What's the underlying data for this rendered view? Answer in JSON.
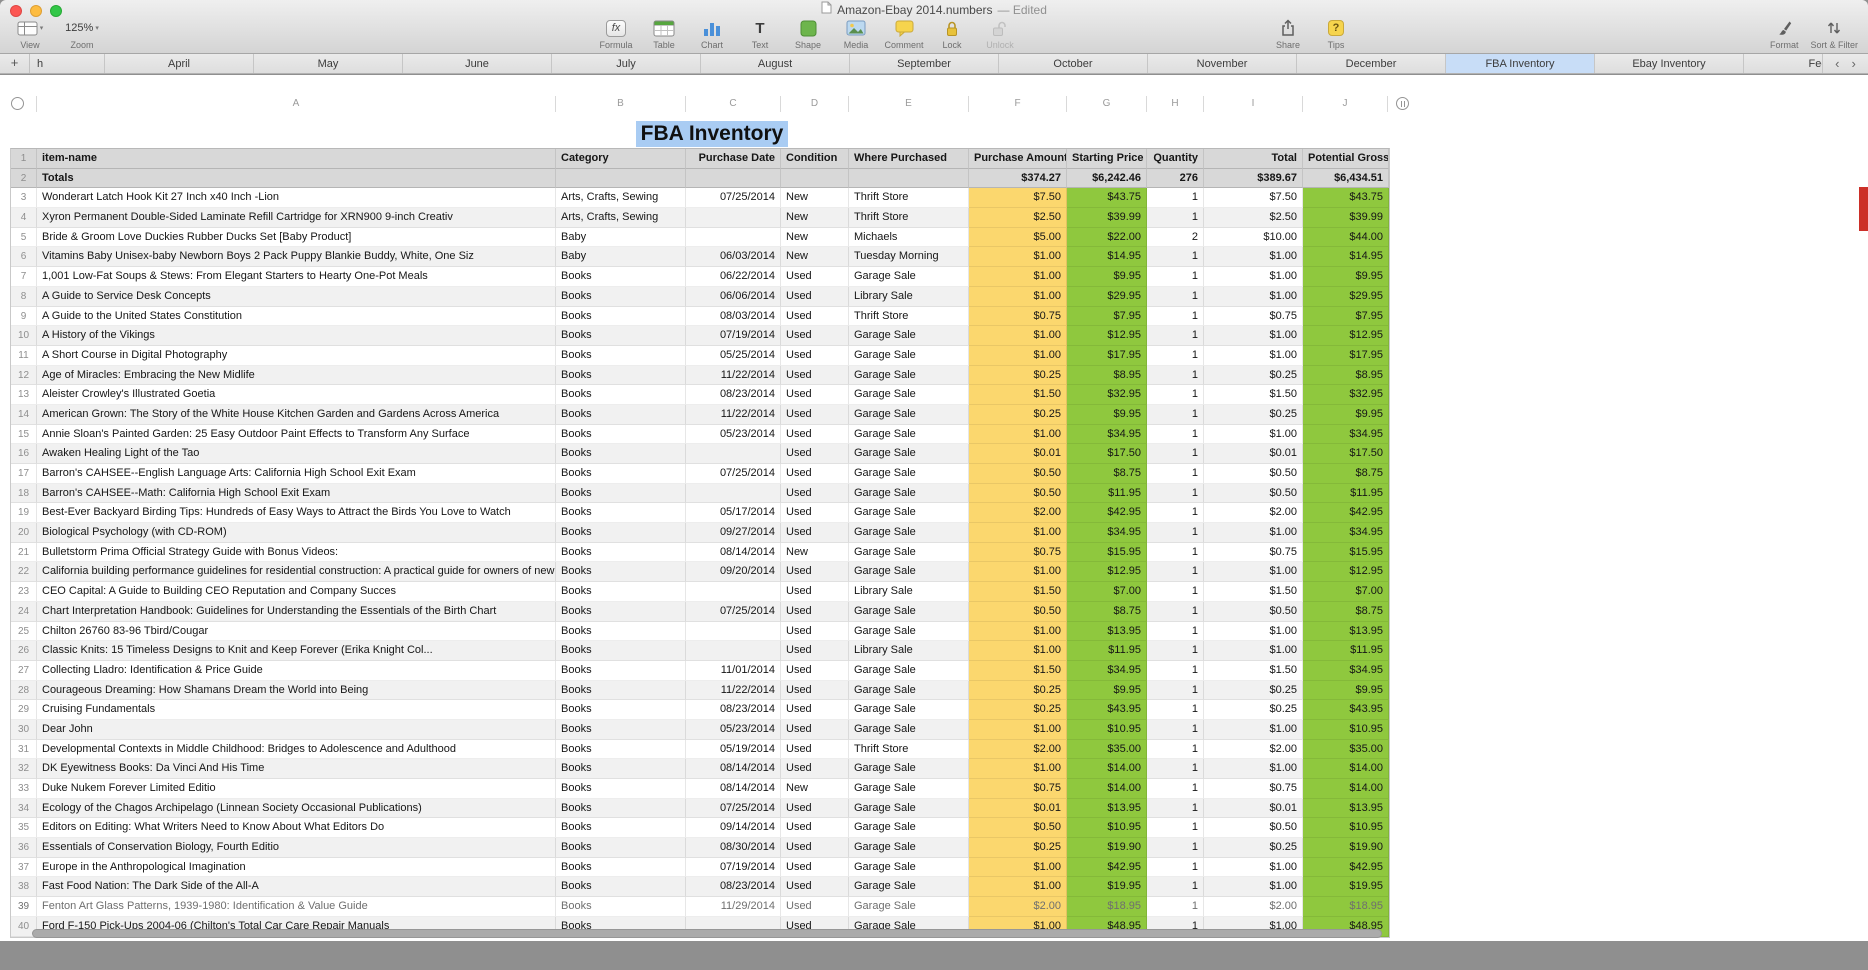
{
  "window": {
    "title": "Amazon-Ebay 2014.numbers",
    "edited": "— Edited"
  },
  "toolbar": {
    "view": {
      "label": "View"
    },
    "zoom": {
      "label": "Zoom",
      "value": "125%"
    },
    "buttons": [
      {
        "label": "Formula"
      },
      {
        "label": "Table"
      },
      {
        "label": "Chart"
      },
      {
        "label": "Text"
      },
      {
        "label": "Shape"
      },
      {
        "label": "Media"
      },
      {
        "label": "Comment"
      },
      {
        "label": "Lock"
      },
      {
        "label": "Unlock"
      }
    ],
    "share": {
      "label": "Share"
    },
    "tips": {
      "label": "Tips"
    },
    "format": {
      "label": "Format"
    },
    "sort_filter": {
      "label": "Sort & Filter"
    }
  },
  "sheet_tabs": {
    "add_label": "+",
    "partial_label": "h",
    "items": [
      "April",
      "May",
      "June",
      "July",
      "August",
      "September",
      "October",
      "November",
      "December",
      "FBA Inventory",
      "Ebay Inventory",
      "Fee"
    ],
    "selected": "FBA Inventory",
    "nav_prev": "‹",
    "nav_next": "›"
  },
  "column_letters": [
    "A",
    "B",
    "C",
    "D",
    "E",
    "F",
    "G",
    "H",
    "I",
    "J"
  ],
  "sheet": {
    "title": "FBA Inventory",
    "table": {
      "header_row": {
        "num": "1",
        "cells": [
          "item-name",
          "Category",
          "Purchase Date",
          "Condition",
          "Where Purchased",
          "Purchase Amount",
          "Starting Price",
          "Quantity",
          "Total",
          "Potential Gross"
        ]
      },
      "totals_row": {
        "num": "2",
        "cells": [
          "Totals",
          "",
          "",
          "",
          "",
          "$374.27",
          "$6,242.46",
          "276",
          "$389.67",
          "$6,434.51"
        ]
      },
      "muted_row_numbers": [
        "39"
      ],
      "rows": [
        [
          "3",
          "Wonderart Latch Hook Kit 27 Inch x40 Inch -Lion",
          "Arts, Crafts, Sewing",
          "07/25/2014",
          "New",
          "Thrift Store",
          "$7.50",
          "$43.75",
          "1",
          "$7.50",
          "$43.75"
        ],
        [
          "4",
          "Xyron Permanent Double-Sided Laminate Refill Cartridge for XRN900 9-inch Creativ",
          "Arts, Crafts, Sewing",
          "",
          "New",
          "Thrift Store",
          "$2.50",
          "$39.99",
          "1",
          "$2.50",
          "$39.99"
        ],
        [
          "5",
          "Bride & Groom Love Duckies Rubber Ducks Set [Baby Product]",
          "Baby",
          "",
          "New",
          "Michaels",
          "$5.00",
          "$22.00",
          "2",
          "$10.00",
          "$44.00"
        ],
        [
          "6",
          "Vitamins Baby Unisex-baby Newborn Boys 2 Pack Puppy Blankie Buddy, White, One Siz",
          "Baby",
          "06/03/2014",
          "New",
          "Tuesday Morning",
          "$1.00",
          "$14.95",
          "1",
          "$1.00",
          "$14.95"
        ],
        [
          "7",
          "1,001 Low-Fat Soups & Stews: From Elegant Starters to Hearty One-Pot Meals",
          "Books",
          "06/22/2014",
          "Used",
          "Garage Sale",
          "$1.00",
          "$9.95",
          "1",
          "$1.00",
          "$9.95"
        ],
        [
          "8",
          "A Guide to Service Desk Concepts",
          "Books",
          "06/06/2014",
          "Used",
          "Library Sale",
          "$1.00",
          "$29.95",
          "1",
          "$1.00",
          "$29.95"
        ],
        [
          "9",
          "A Guide to the United States Constitution",
          "Books",
          "08/03/2014",
          "Used",
          "Thrift Store",
          "$0.75",
          "$7.95",
          "1",
          "$0.75",
          "$7.95"
        ],
        [
          "10",
          "A History of the Vikings",
          "Books",
          "07/19/2014",
          "Used",
          "Garage Sale",
          "$1.00",
          "$12.95",
          "1",
          "$1.00",
          "$12.95"
        ],
        [
          "11",
          "A Short Course in Digital Photography",
          "Books",
          "05/25/2014",
          "Used",
          "Garage Sale",
          "$1.00",
          "$17.95",
          "1",
          "$1.00",
          "$17.95"
        ],
        [
          "12",
          "Age of Miracles: Embracing the New Midlife",
          "Books",
          "11/22/2014",
          "Used",
          "Garage Sale",
          "$0.25",
          "$8.95",
          "1",
          "$0.25",
          "$8.95"
        ],
        [
          "13",
          "Aleister Crowley's Illustrated Goetia",
          "Books",
          "08/23/2014",
          "Used",
          "Garage Sale",
          "$1.50",
          "$32.95",
          "1",
          "$1.50",
          "$32.95"
        ],
        [
          "14",
          "American Grown: The Story of the White House Kitchen Garden and Gardens Across America",
          "Books",
          "11/22/2014",
          "Used",
          "Garage Sale",
          "$0.25",
          "$9.95",
          "1",
          "$0.25",
          "$9.95"
        ],
        [
          "15",
          "Annie Sloan's Painted Garden: 25 Easy Outdoor Paint Effects to Transform Any Surface",
          "Books",
          "05/23/2014",
          "Used",
          "Garage Sale",
          "$1.00",
          "$34.95",
          "1",
          "$1.00",
          "$34.95"
        ],
        [
          "16",
          "Awaken Healing Light of the Tao",
          "Books",
          "",
          "Used",
          "Garage Sale",
          "$0.01",
          "$17.50",
          "1",
          "$0.01",
          "$17.50"
        ],
        [
          "17",
          "Barron's CAHSEE--English Language Arts: California High School Exit Exam",
          "Books",
          "07/25/2014",
          "Used",
          "Garage Sale",
          "$0.50",
          "$8.75",
          "1",
          "$0.50",
          "$8.75"
        ],
        [
          "18",
          "Barron's CAHSEE--Math: California High School Exit Exam",
          "Books",
          "",
          "Used",
          "Garage Sale",
          "$0.50",
          "$11.95",
          "1",
          "$0.50",
          "$11.95"
        ],
        [
          "19",
          "Best-Ever Backyard Birding Tips: Hundreds of Easy Ways to Attract the Birds You Love to Watch",
          "Books",
          "05/17/2014",
          "Used",
          "Garage Sale",
          "$2.00",
          "$42.95",
          "1",
          "$2.00",
          "$42.95"
        ],
        [
          "20",
          "Biological Psychology (with CD-ROM)",
          "Books",
          "09/27/2014",
          "Used",
          "Garage Sale",
          "$1.00",
          "$34.95",
          "1",
          "$1.00",
          "$34.95"
        ],
        [
          "21",
          "Bulletstorm Prima Official Strategy Guide with Bonus Videos:",
          "Books",
          "08/14/2014",
          "New",
          "Garage Sale",
          "$0.75",
          "$15.95",
          "1",
          "$0.75",
          "$15.95"
        ],
        [
          "22",
          "California building performance guidelines for residential construction: A practical guide for owners of new homes : constr",
          "Books",
          "09/20/2014",
          "Used",
          "Garage Sale",
          "$1.00",
          "$12.95",
          "1",
          "$1.00",
          "$12.95"
        ],
        [
          "23",
          "CEO Capital: A Guide to Building CEO Reputation and Company Succes",
          "Books",
          "",
          "Used",
          "Library Sale",
          "$1.50",
          "$7.00",
          "1",
          "$1.50",
          "$7.00"
        ],
        [
          "24",
          "Chart Interpretation Handbook: Guidelines for Understanding the Essentials of the Birth Chart",
          "Books",
          "07/25/2014",
          "Used",
          "Garage Sale",
          "$0.50",
          "$8.75",
          "1",
          "$0.50",
          "$8.75"
        ],
        [
          "25",
          "Chilton 26760 83-96 Tbird/Cougar",
          "Books",
          "",
          "Used",
          "Garage Sale",
          "$1.00",
          "$13.95",
          "1",
          "$1.00",
          "$13.95"
        ],
        [
          "26",
          "Classic Knits: 15 Timeless Designs to Knit and Keep Forever (Erika Knight Col...",
          "Books",
          "",
          "Used",
          "Library Sale",
          "$1.00",
          "$11.95",
          "1",
          "$1.00",
          "$11.95"
        ],
        [
          "27",
          "Collecting Lladro: Identification & Price Guide",
          "Books",
          "11/01/2014",
          "Used",
          "Garage Sale",
          "$1.50",
          "$34.95",
          "1",
          "$1.50",
          "$34.95"
        ],
        [
          "28",
          "Courageous Dreaming: How Shamans Dream the World into Being",
          "Books",
          "11/22/2014",
          "Used",
          "Garage Sale",
          "$0.25",
          "$9.95",
          "1",
          "$0.25",
          "$9.95"
        ],
        [
          "29",
          "Cruising Fundamentals",
          "Books",
          "08/23/2014",
          "Used",
          "Garage Sale",
          "$0.25",
          "$43.95",
          "1",
          "$0.25",
          "$43.95"
        ],
        [
          "30",
          "Dear John",
          "Books",
          "05/23/2014",
          "Used",
          "Garage Sale",
          "$1.00",
          "$10.95",
          "1",
          "$1.00",
          "$10.95"
        ],
        [
          "31",
          "Developmental Contexts in Middle Childhood: Bridges to Adolescence and Adulthood",
          "Books",
          "05/19/2014",
          "Used",
          "Thrift Store",
          "$2.00",
          "$35.00",
          "1",
          "$2.00",
          "$35.00"
        ],
        [
          "32",
          "DK Eyewitness Books: Da Vinci And His Time",
          "Books",
          "08/14/2014",
          "Used",
          "Garage Sale",
          "$1.00",
          "$14.00",
          "1",
          "$1.00",
          "$14.00"
        ],
        [
          "33",
          "Duke Nukem Forever Limited Editio",
          "Books",
          "08/14/2014",
          "New",
          "Garage Sale",
          "$0.75",
          "$14.00",
          "1",
          "$0.75",
          "$14.00"
        ],
        [
          "34",
          "Ecology of the Chagos Archipelago (Linnean Society Occasional Publications)",
          "Books",
          "07/25/2014",
          "Used",
          "Garage Sale",
          "$0.01",
          "$13.95",
          "1",
          "$0.01",
          "$13.95"
        ],
        [
          "35",
          "Editors on Editing: What Writers Need to Know About What Editors Do",
          "Books",
          "09/14/2014",
          "Used",
          "Garage Sale",
          "$0.50",
          "$10.95",
          "1",
          "$0.50",
          "$10.95"
        ],
        [
          "36",
          "Essentials of Conservation Biology, Fourth Editio",
          "Books",
          "08/30/2014",
          "Used",
          "Garage Sale",
          "$0.25",
          "$19.90",
          "1",
          "$0.25",
          "$19.90"
        ],
        [
          "37",
          "Europe in the Anthropological Imagination",
          "Books",
          "07/19/2014",
          "Used",
          "Garage Sale",
          "$1.00",
          "$42.95",
          "1",
          "$1.00",
          "$42.95"
        ],
        [
          "38",
          "Fast Food Nation: The Dark Side of the All-A",
          "Books",
          "08/23/2014",
          "Used",
          "Garage Sale",
          "$1.00",
          "$19.95",
          "1",
          "$1.00",
          "$19.95"
        ],
        [
          "39",
          "Fenton Art Glass Patterns, 1939-1980: Identification & Value Guide",
          "Books",
          "11/29/2014",
          "Used",
          "Garage Sale",
          "$2.00",
          "$18.95",
          "1",
          "$2.00",
          "$18.95"
        ],
        [
          "40",
          "Ford F-150 Pick-Ups 2004-06 (Chilton's Total Car Care Repair Manuals",
          "Books",
          "",
          "Used",
          "Garage Sale",
          "$1.00",
          "$48.95",
          "1",
          "$1.00",
          "$48.95"
        ]
      ]
    }
  },
  "colors": {
    "purchase_amount_bg": "#FBD76E",
    "price_bg": "#8FC83E",
    "header_bg": "#D8D8D8",
    "stripe_bg": "#F1F1F1",
    "selected_tab_bg": "#C8DDF7",
    "title_selection_bg": "#A9CCF3"
  }
}
